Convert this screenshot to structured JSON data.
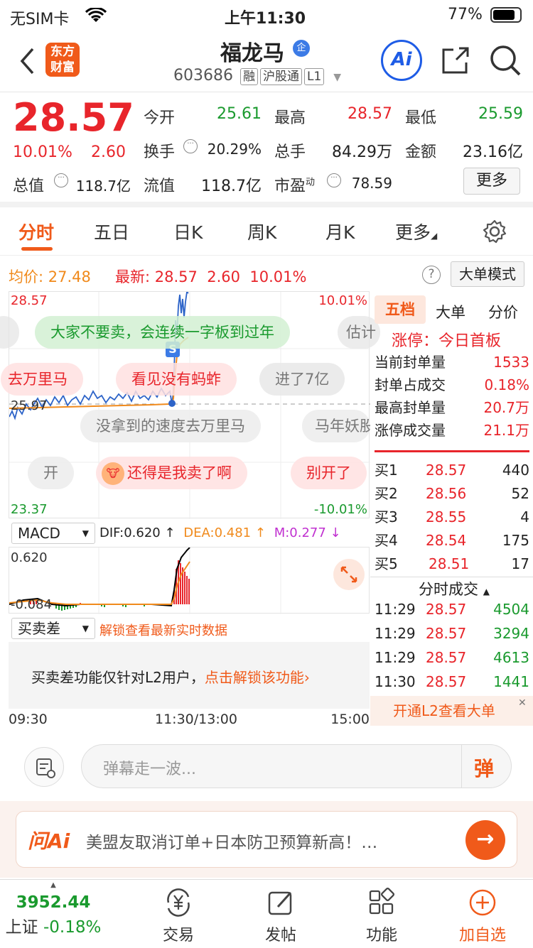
{
  "status": {
    "carrier": "无SIM卡",
    "time": "上午11:30",
    "battery": "77%"
  },
  "header": {
    "logo_line1": "东方",
    "logo_line2": "财富",
    "stock_name": "福龙马",
    "stock_badge": "企",
    "code": "603686",
    "tags": [
      "融",
      "沪股通",
      "L1"
    ],
    "ai_label": "Ai"
  },
  "quote": {
    "price": "28.57",
    "pct": "10.01%",
    "change": "2.60",
    "rows": [
      {
        "label": "今开",
        "value": "25.61",
        "color": "#1a9a2e"
      },
      {
        "label": "最高",
        "value": "28.57",
        "color": "#e8252b"
      },
      {
        "label": "最低",
        "value": "25.59",
        "color": "#1a9a2e"
      },
      {
        "label": "换手",
        "value": "20.29%",
        "color": "#222"
      },
      {
        "label": "总手",
        "value": "84.29万",
        "color": "#222"
      },
      {
        "label": "金额",
        "value": "23.16亿",
        "color": "#222"
      }
    ],
    "total_value_label": "总值",
    "total_value": "118.7亿",
    "float_label": "流值",
    "float_value": "118.7亿",
    "pe_label": "市盈",
    "pe_sup": "动",
    "pe_value": "78.59",
    "more_label": "更多"
  },
  "tabs": [
    "分时",
    "五日",
    "日K",
    "周K",
    "月K",
    "更多"
  ],
  "info": {
    "avg_label": "均价:",
    "avg": "27.48",
    "latest_label": "最新:",
    "latest": "28.57",
    "chg": "2.60",
    "pct": "10.01%",
    "help": "?",
    "mode_button": "大单模式"
  },
  "chart": {
    "y_top": "28.57",
    "y_mid": "25.97",
    "y_bot": "23.37",
    "pct_top": "10.01%",
    "pct_bot": "-10.01%",
    "s_marker": "S",
    "danmaku": [
      "大家不要卖，会连续一字板到过年",
      "估计",
      "去万里马",
      "看见没有蚂蚱",
      "进了7亿",
      "没拿到的速度去万里马",
      "马年妖股",
      "开",
      "还得是我卖了啊",
      "别开了"
    ],
    "watermark": "东方财富"
  },
  "macd": {
    "select": "MACD",
    "dif": "DIF:0.620",
    "dea": "DEA:0.481",
    "m": "M:0.277",
    "top": "0.620",
    "bot": "-0.084"
  },
  "spread": {
    "select": "买卖差",
    "unlock": "解锁查看最新实时数据",
    "msg": "买卖差功能仅针对L2用户，",
    "link": "点击解锁该功能"
  },
  "time_axis": [
    "09:30",
    "11:30/13:00",
    "15:00"
  ],
  "panel": {
    "tabs": [
      "五档",
      "大单",
      "分价"
    ],
    "limit_up": "涨停：今日首板",
    "stats": [
      [
        "当前封单量",
        "1533"
      ],
      [
        "封单占成交",
        "0.18%"
      ],
      [
        "最高封单量",
        "20.7万"
      ],
      [
        "涨停成交量",
        "21.1万"
      ]
    ],
    "book": [
      [
        "买1",
        "28.57",
        "440"
      ],
      [
        "买2",
        "28.56",
        "52"
      ],
      [
        "买3",
        "28.55",
        "4"
      ],
      [
        "买4",
        "28.54",
        "175"
      ],
      [
        "买5",
        "28.51",
        "17"
      ]
    ],
    "ticks_title": "分时成交",
    "ticks": [
      [
        "11:29",
        "28.57",
        "4504"
      ],
      [
        "11:29",
        "28.57",
        "3294"
      ],
      [
        "11:29",
        "28.57",
        "4613"
      ],
      [
        "11:30",
        "28.57",
        "1441"
      ]
    ],
    "promo": "开通L2查看大单",
    "promo_close": "✕"
  },
  "danmu_input": {
    "placeholder": "弹幕走一波...",
    "send": "弹"
  },
  "ai": {
    "logo": "问Ai",
    "text": "美盟友取消订单+日本防卫预算新高！…",
    "arrow": "→"
  },
  "tabbar": {
    "index_value": "3952.44",
    "index_name": "上证",
    "index_change": "-0.18%",
    "items": [
      "交易",
      "发帖",
      "功能",
      "加自选"
    ]
  },
  "colors": {
    "up": "#e8252b",
    "down": "#1a9a2e",
    "accent": "#f05a1a"
  }
}
